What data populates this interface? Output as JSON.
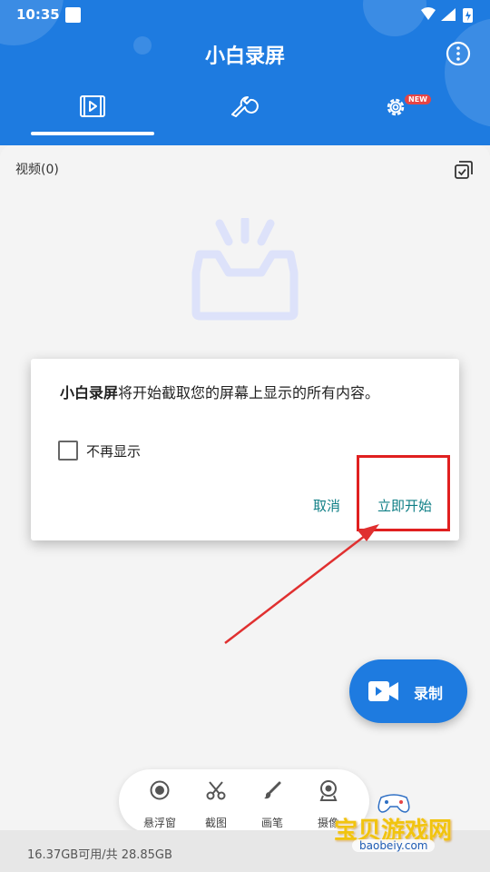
{
  "status_bar": {
    "time": "10:35"
  },
  "header": {
    "title": "小白录屏",
    "tabs": [
      {
        "name": "videos",
        "icon": "video-list-icon",
        "active": true
      },
      {
        "name": "tools",
        "icon": "wrench-icon",
        "active": false
      },
      {
        "name": "settings",
        "icon": "gear-icon",
        "active": false,
        "badge": "NEW"
      }
    ]
  },
  "content": {
    "video_count_label": "视频(0)"
  },
  "dialog": {
    "app_name": "小白录屏",
    "message": "将开始截取您的屏幕上显示的所有内容。",
    "checkbox_label": "不再显示",
    "checkbox_checked": false,
    "cancel_label": "取消",
    "confirm_label": "立即开始"
  },
  "fab": {
    "label": "录制"
  },
  "toolbar": {
    "items": [
      {
        "label": "悬浮窗",
        "icon": "floating-window-icon"
      },
      {
        "label": "截图",
        "icon": "scissors-icon"
      },
      {
        "label": "画笔",
        "icon": "brush-icon"
      },
      {
        "label": "摄像",
        "icon": "webcam-icon"
      }
    ]
  },
  "footer": {
    "storage": "16.37GB可用/共 28.85GB"
  },
  "watermark": {
    "name": "宝贝游戏网",
    "url": "baobeiy.com"
  },
  "colors": {
    "brand": "#1e7be0",
    "accent_text": "#0f7f86",
    "highlight": "#e02020",
    "badge": "#e64545"
  }
}
